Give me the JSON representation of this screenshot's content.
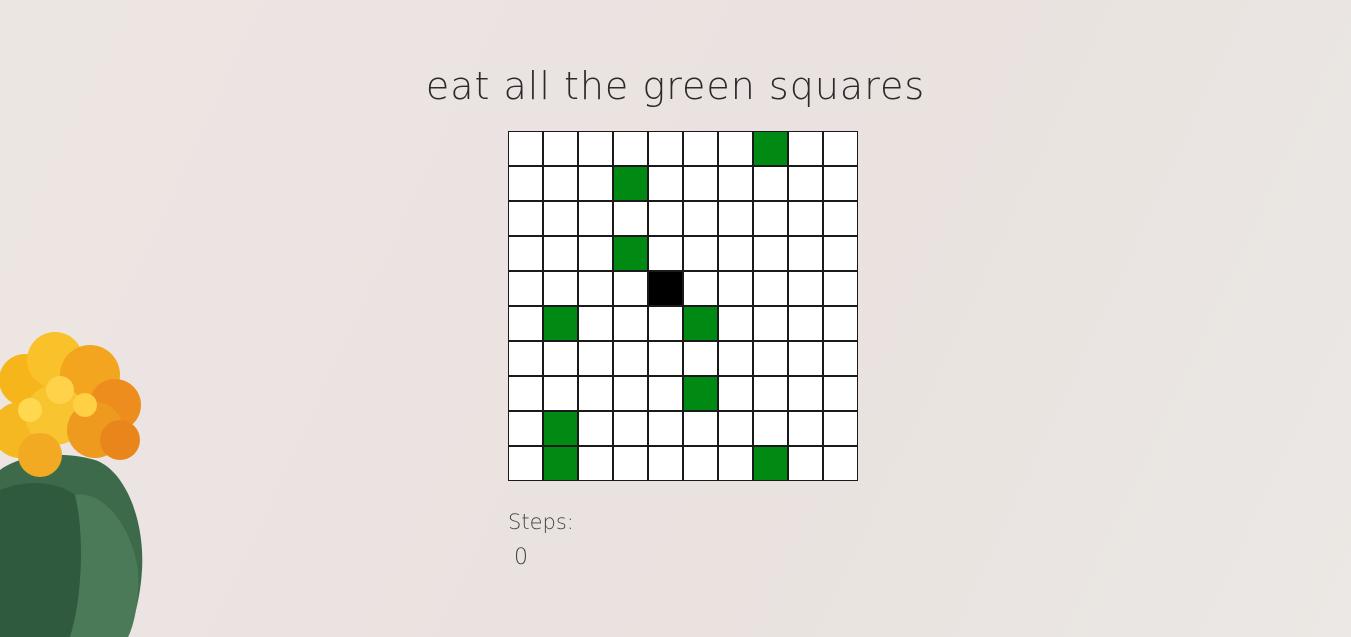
{
  "title": "eat all the green squares",
  "steps": {
    "label": "Steps:",
    "value": "0"
  },
  "board": {
    "rows": 10,
    "cols": 10,
    "player": [
      4,
      4
    ],
    "food": [
      [
        0,
        7
      ],
      [
        1,
        3
      ],
      [
        3,
        3
      ],
      [
        5,
        1
      ],
      [
        5,
        5
      ],
      [
        7,
        5
      ],
      [
        8,
        1
      ],
      [
        9,
        1
      ],
      [
        9,
        7
      ]
    ],
    "colors": {
      "empty": "#ffffff",
      "food": "#008a14",
      "player": "#000000"
    }
  }
}
